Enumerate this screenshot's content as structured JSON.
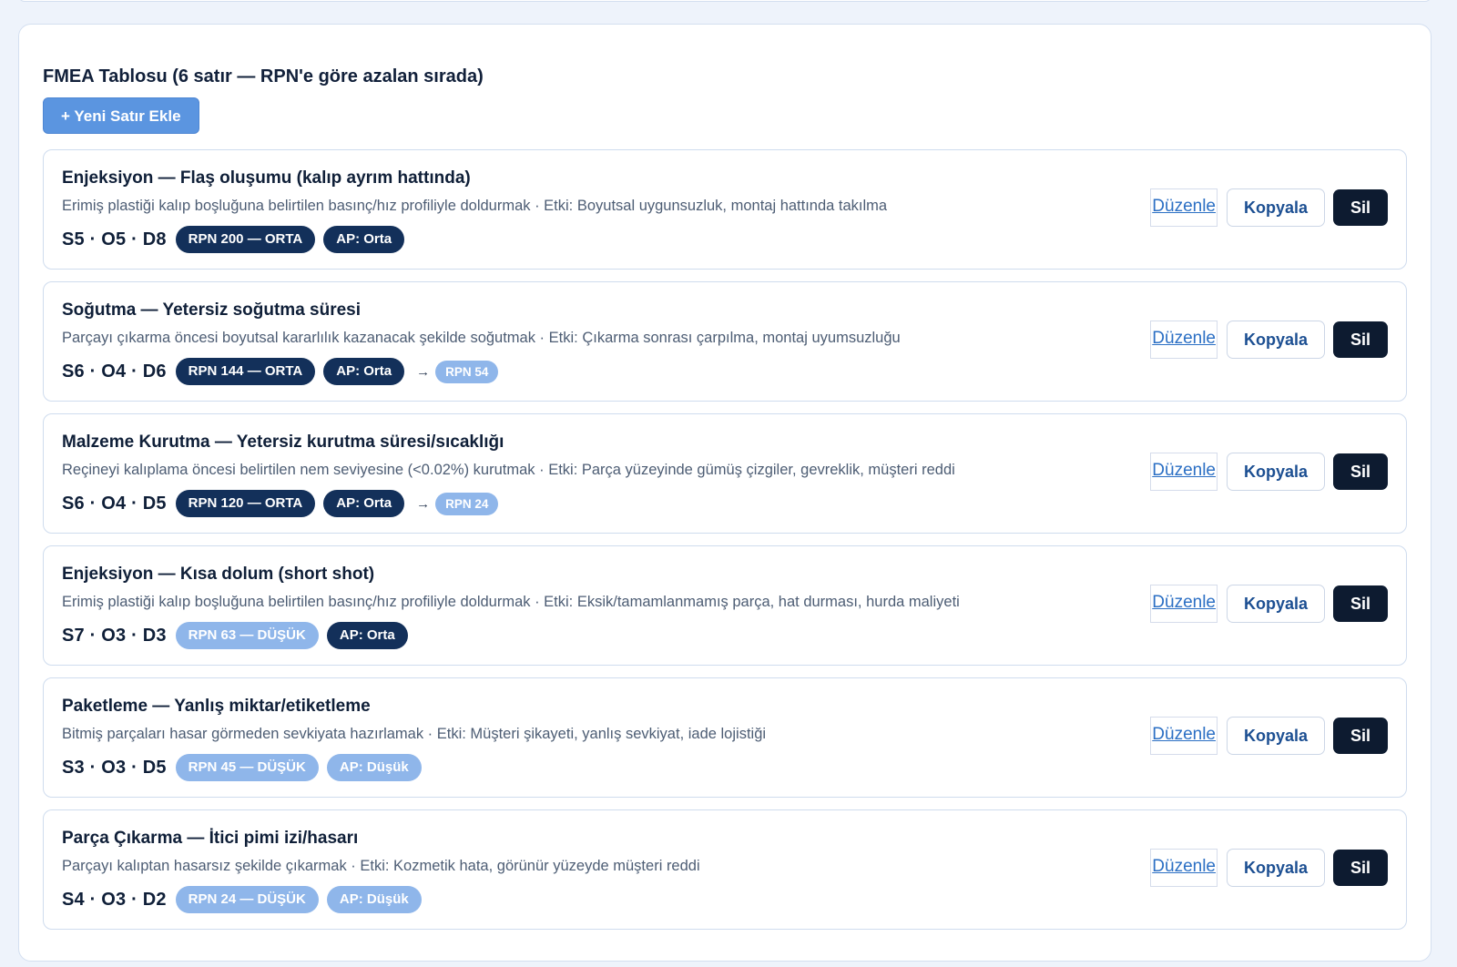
{
  "panel": {
    "title": "FMEA Tablosu (6 satır — RPN'e göre azalan sırada)",
    "add_button": "+ Yeni Satır Ekle"
  },
  "actions": {
    "edit": "Düzenle",
    "copy": "Kopyala",
    "delete": "Sil"
  },
  "rows": [
    {
      "title": "Enjeksiyon — Flaş oluşumu (kalıp ayrım hattında)",
      "desc": "Erimiş plastiği kalıp boşluğuna belirtilen basınç/hız profiliyle doldurmak · Etki: Boyutsal uygunsuzluk, montaj hattında takılma",
      "scores": "S5 · O5 · D8",
      "rpn": "RPN 200 — ORTA",
      "rpn_style": "dark",
      "ap": "AP: Orta",
      "ap_style": "dark",
      "arrow": "",
      "target_rpn": ""
    },
    {
      "title": "Soğutma — Yetersiz soğutma süresi",
      "desc": "Parçayı çıkarma öncesi boyutsal kararlılık kazanacak şekilde soğutmak · Etki: Çıkarma sonrası çarpılma, montaj uyumsuzluğu",
      "scores": "S6 · O4 · D6",
      "rpn": "RPN 144 — ORTA",
      "rpn_style": "dark",
      "ap": "AP: Orta",
      "ap_style": "dark",
      "arrow": "→",
      "target_rpn": "RPN 54"
    },
    {
      "title": "Malzeme Kurutma — Yetersiz kurutma süresi/sıcaklığı",
      "desc": "Reçineyi kalıplama öncesi belirtilen nem seviyesine (<0.02%) kurutmak · Etki: Parça yüzeyinde gümüş çizgiler, gevreklik, müşteri reddi",
      "scores": "S6 · O4 · D5",
      "rpn": "RPN 120 — ORTA",
      "rpn_style": "dark",
      "ap": "AP: Orta",
      "ap_style": "dark",
      "arrow": "→",
      "target_rpn": "RPN 24"
    },
    {
      "title": "Enjeksiyon — Kısa dolum (short shot)",
      "desc": "Erimiş plastiği kalıp boşluğuna belirtilen basınç/hız profiliyle doldurmak · Etki: Eksik/tamamlanmamış parça, hat durması, hurda maliyeti",
      "scores": "S7 · O3 · D3",
      "rpn": "RPN 63 — DÜŞÜK",
      "rpn_style": "light",
      "ap": "AP: Orta",
      "ap_style": "dark",
      "arrow": "",
      "target_rpn": ""
    },
    {
      "title": "Paketleme — Yanlış miktar/etiketleme",
      "desc": "Bitmiş parçaları hasar görmeden sevkiyata hazırlamak · Etki: Müşteri şikayeti, yanlış sevkiyat, iade lojistiği",
      "scores": "S3 · O3 · D5",
      "rpn": "RPN 45 — DÜŞÜK",
      "rpn_style": "light",
      "ap": "AP: Düşük",
      "ap_style": "light",
      "arrow": "",
      "target_rpn": ""
    },
    {
      "title": "Parça Çıkarma — İtici pimi izi/hasarı",
      "desc": "Parçayı kalıptan hasarsız şekilde çıkarmak · Etki: Kozmetik hata, görünür yüzeyde müşteri reddi",
      "scores": "S4 · O3 · D2",
      "rpn": "RPN 24 — DÜŞÜK",
      "rpn_style": "light",
      "ap": "AP: Düşük",
      "ap_style": "light",
      "arrow": "",
      "target_rpn": ""
    }
  ]
}
